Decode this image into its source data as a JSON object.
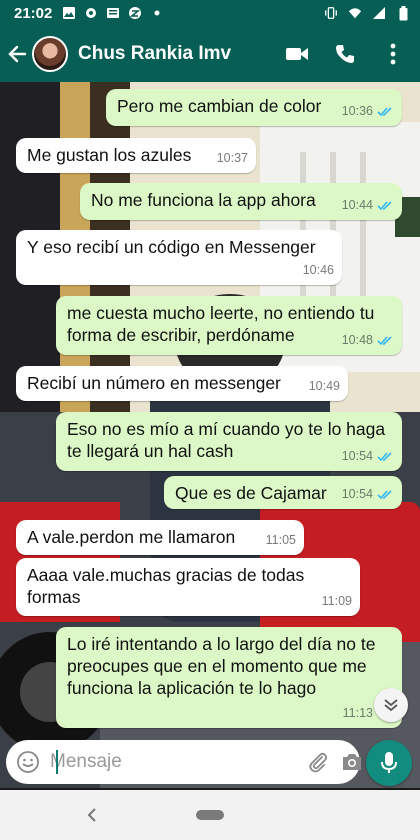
{
  "status": {
    "time": "21:02",
    "icons": [
      "image-icon",
      "gear-icon",
      "news-icon",
      "app-badge-icon",
      "dot-icon"
    ],
    "right_icons": [
      "vibrate-icon",
      "wifi-icon",
      "signal-icon",
      "battery-icon"
    ]
  },
  "header": {
    "contact_name": "Chus Rankia Imv",
    "actions": [
      "video-call-icon",
      "phone-icon",
      "more-vert-icon"
    ]
  },
  "messages": [
    {
      "dir": "out",
      "text": "Pero me cambian de color",
      "time": "10:36",
      "read": true
    },
    {
      "dir": "in",
      "text": "Me gustan los azules",
      "time": "10:37"
    },
    {
      "dir": "out",
      "text": "No me funciona la app ahora",
      "time": "10:44",
      "read": true
    },
    {
      "dir": "in",
      "text": "Y eso recibí un código en Messenger",
      "time": "10:46"
    },
    {
      "dir": "out",
      "text": "me cuesta mucho leerte, no entiendo tu forma de escribir, perdóname",
      "time": "10:48",
      "read": true
    },
    {
      "dir": "in",
      "text": "Recibí un número en messenger",
      "time": "10:49"
    },
    {
      "dir": "out",
      "text": "Eso no es mío a mí cuando yo te lo haga te llegará un hal cash",
      "time": "10:54",
      "read": true
    },
    {
      "dir": "out",
      "text": "Que es de Cajamar",
      "time": "10:54",
      "read": true
    },
    {
      "dir": "in",
      "text": "A vale.perdon me llamaron",
      "time": "11:05"
    },
    {
      "dir": "in",
      "text": "Aaaa vale.muchas gracias de todas formas",
      "time": "11:09"
    },
    {
      "dir": "out",
      "text": "Lo iré intentando a lo largo del día no te preocupes que en el momento que me funciona la aplicación te lo hago",
      "time": "11:13",
      "read": true
    }
  ],
  "composer": {
    "placeholder": "Mensaje",
    "value": ""
  },
  "colors": {
    "header": "#075E54",
    "bubble_out": "#dcf8c6",
    "bubble_in": "#ffffff",
    "read_tick": "#34B7F1",
    "mic_button": "#128C7E"
  }
}
